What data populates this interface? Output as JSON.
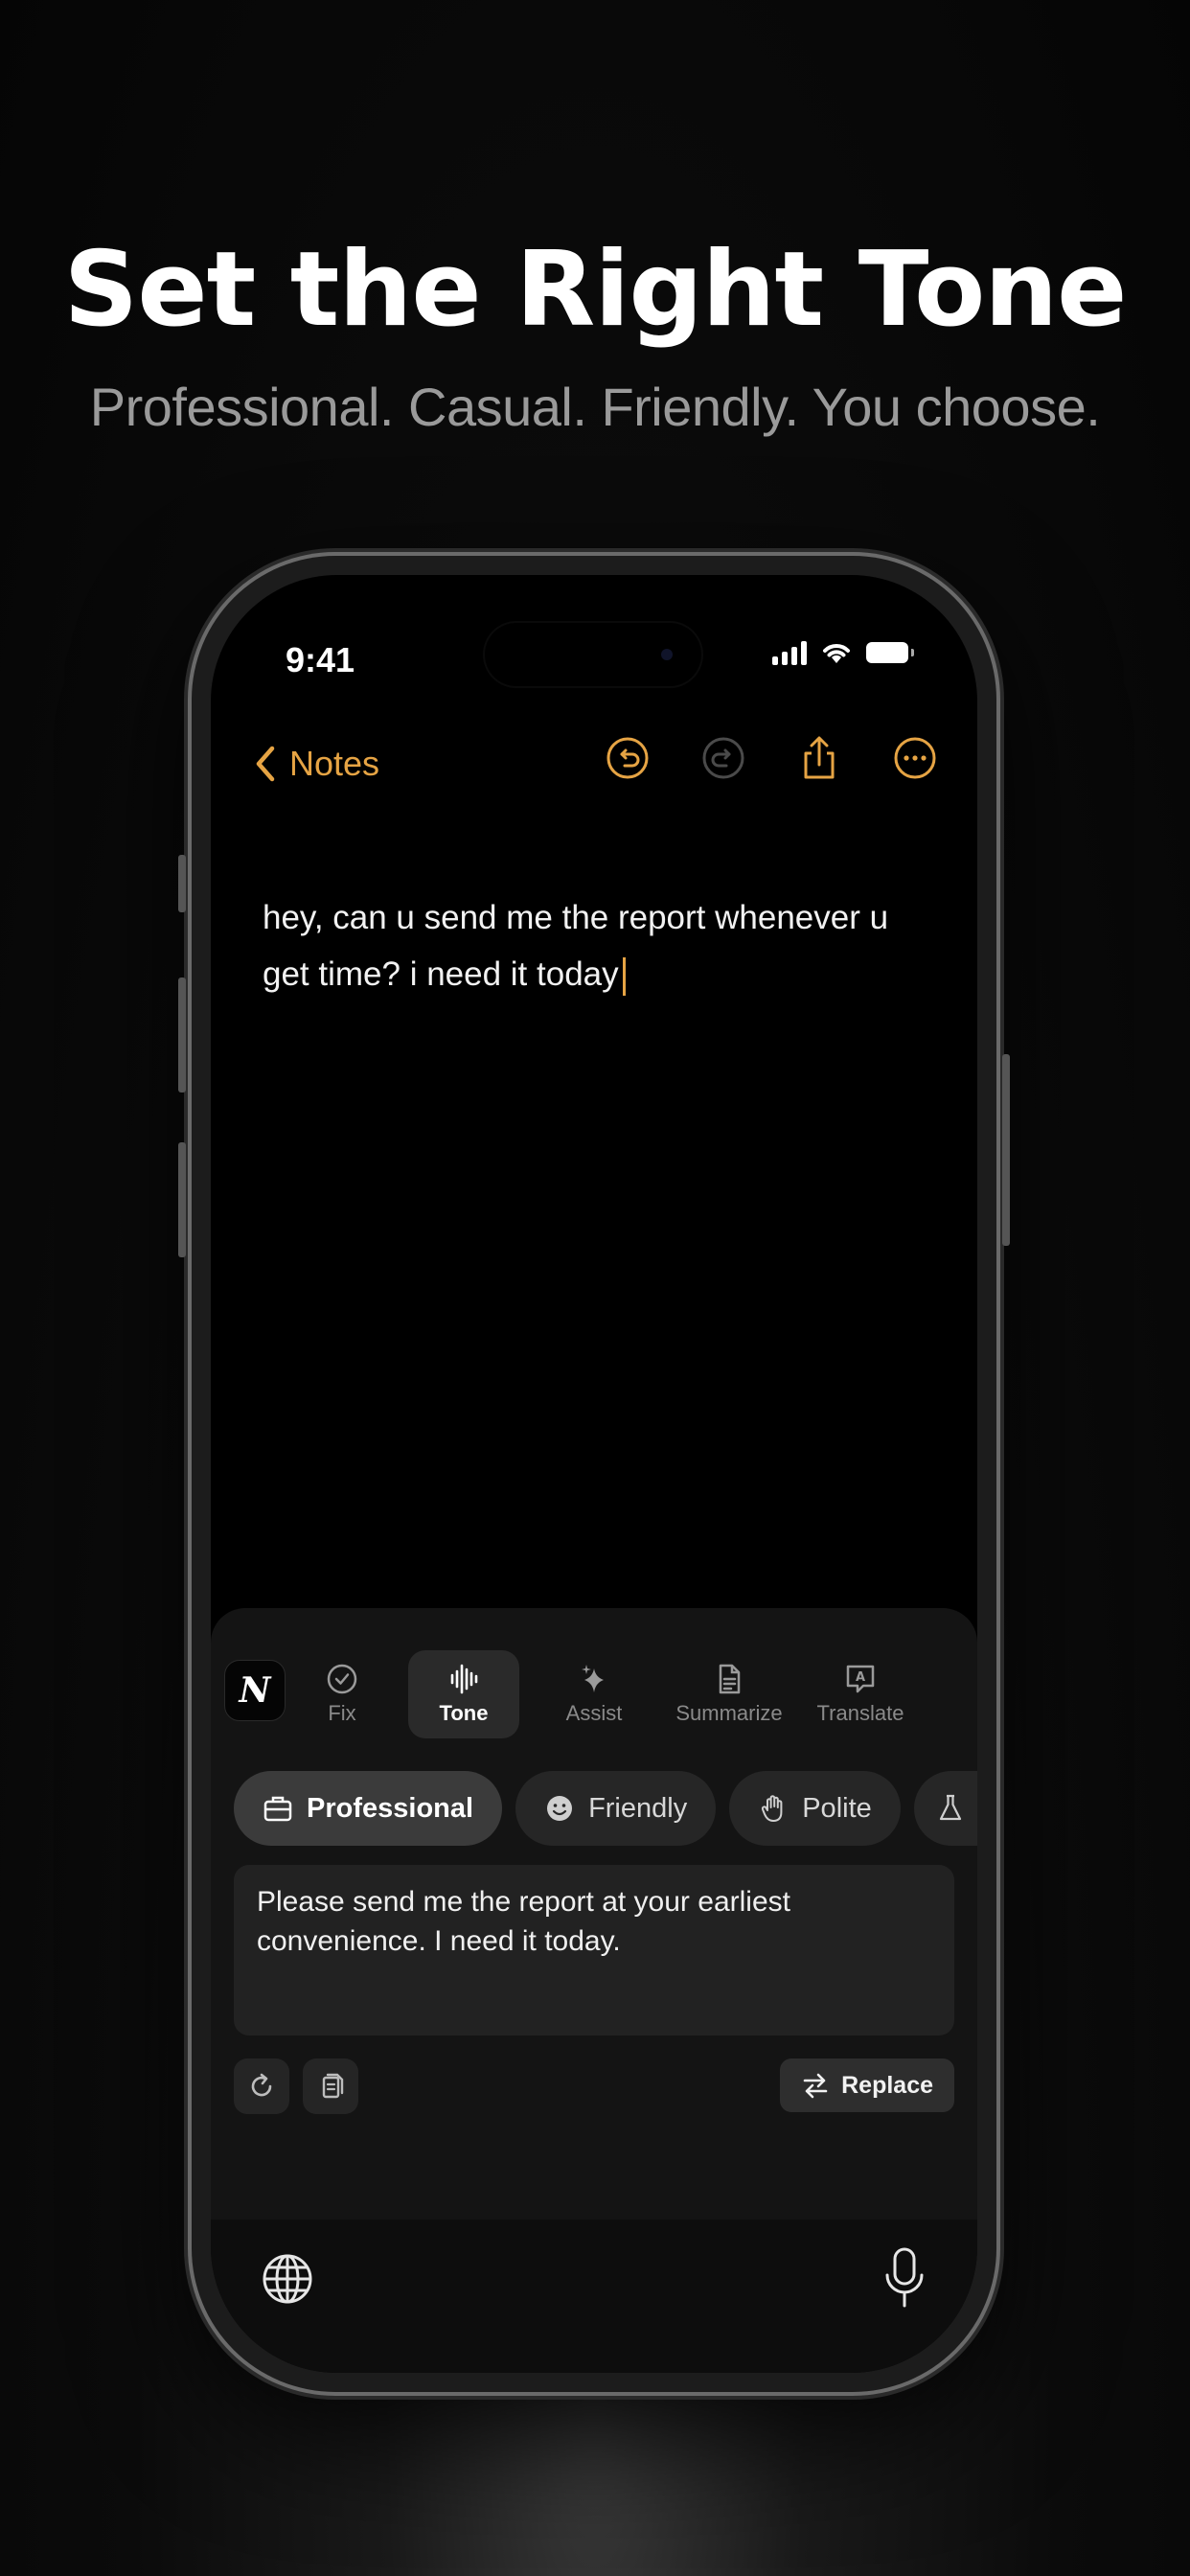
{
  "promo": {
    "headline": "Set the Right Tone",
    "subline": "Professional. Casual. Friendly. You choose."
  },
  "status_bar": {
    "time": "9:41"
  },
  "navbar": {
    "back_label": "Notes",
    "icons": [
      "undo-icon",
      "redo-icon",
      "share-icon",
      "more-icon"
    ]
  },
  "note": {
    "text": "hey, can u send me the report whenever u get time? i need it today"
  },
  "keyboard": {
    "logo": "N",
    "tools": [
      {
        "label": "Fix",
        "icon": "check-circle-icon"
      },
      {
        "label": "Tone",
        "icon": "waveform-icon",
        "active": true
      },
      {
        "label": "Assist",
        "icon": "sparkle-icon"
      },
      {
        "label": "Summarize",
        "icon": "document-icon"
      },
      {
        "label": "Translate",
        "icon": "translate-icon"
      }
    ],
    "tones": [
      {
        "label": "Professional",
        "icon": "briefcase-icon",
        "active": true
      },
      {
        "label": "Friendly",
        "icon": "smile-icon"
      },
      {
        "label": "Polite",
        "icon": "hand-icon"
      }
    ],
    "result_text": "Please send me the report at your earliest convenience. I need it today.",
    "replace_label": "Replace"
  },
  "colors": {
    "accent": "#e6a444",
    "background": "#000000",
    "panel": "#141414"
  }
}
